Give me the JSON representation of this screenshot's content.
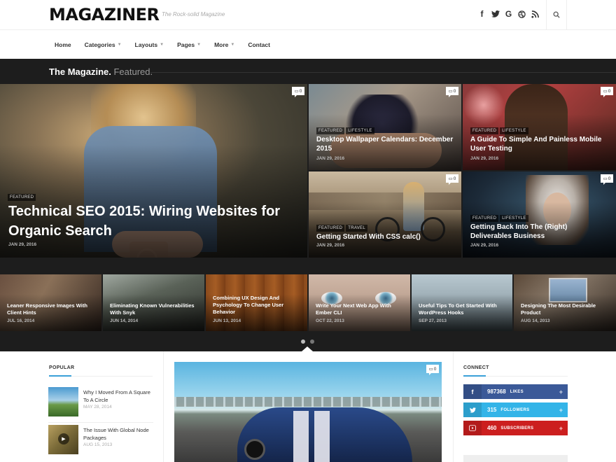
{
  "brand": {
    "logo": "MAGAZINER",
    "tagline": "The Rock-solid Magazine"
  },
  "social_icons": [
    "facebook-icon",
    "twitter-icon",
    "google-icon",
    "dribbble-icon",
    "rss-icon"
  ],
  "nav": [
    {
      "label": "Home",
      "has_caret": false
    },
    {
      "label": "Categories",
      "has_caret": true
    },
    {
      "label": "Layouts",
      "has_caret": true
    },
    {
      "label": "Pages",
      "has_caret": true
    },
    {
      "label": "More",
      "has_caret": true
    },
    {
      "label": "Contact",
      "has_caret": false
    }
  ],
  "featured": {
    "title": "The Magazine.",
    "subtitle": "Featured.",
    "big": {
      "cats": [
        "FEATURED"
      ],
      "title": "Technical SEO 2015: Wiring Websites for Organic Search",
      "date": "JAN 29, 2016",
      "comments": "0"
    },
    "small": [
      {
        "cats": [
          "FEATURED",
          "LIFESTYLE"
        ],
        "title": "Desktop Wallpaper Calendars: December 2015",
        "date": "JAN 29, 2016",
        "comments": "0"
      },
      {
        "cats": [
          "FEATURED",
          "LIFESTYLE"
        ],
        "title": "A Guide To Simple And Painless Mobile User Testing",
        "date": "JAN 29, 2016",
        "comments": "0"
      },
      {
        "cats": [
          "FEATURED",
          "TRAVEL"
        ],
        "title": "Getting Started With CSS calc()",
        "date": "JAN 29, 2016",
        "comments": "0"
      },
      {
        "cats": [
          "FEATURED",
          "LIFESTYLE"
        ],
        "title": "Getting Back Into The (Right) Deliverables Business",
        "date": "JAN 29, 2016",
        "comments": "0"
      }
    ]
  },
  "carousel": [
    {
      "title": "Leaner Responsive Images With Client Hints",
      "date": "JUL 16, 2014"
    },
    {
      "title": "Eliminating Known Vulnerabilities With Snyk",
      "date": "JUN 14, 2014"
    },
    {
      "title": "Combining UX Design And Psychology To Change User Behavior",
      "date": "JUN 13, 2014"
    },
    {
      "title": "Write Your Next Web App With Ember CLI",
      "date": "OCT 22, 2013"
    },
    {
      "title": "Useful Tips To Get Started With WordPress Hooks",
      "date": "SEP 27, 2013"
    },
    {
      "title": "Designing The Most Desirable Product",
      "date": "AUG 14, 2013"
    }
  ],
  "popular": {
    "heading": "POPULAR",
    "items": [
      {
        "title": "Why I Moved From A Square To A Circle",
        "date": "MAY 28, 2014"
      },
      {
        "title": "The Issue With Global Node Packages",
        "date": "AUG 15, 2013"
      }
    ]
  },
  "main_post": {
    "comments": "0"
  },
  "connect": {
    "heading": "CONNECT",
    "items": [
      {
        "icon": "facebook-icon",
        "count": "987368",
        "label": "LIKES",
        "color": "#3b5998"
      },
      {
        "icon": "twitter-icon",
        "count": "315",
        "label": "FOLLOWERS",
        "color": "#33b4e8"
      },
      {
        "icon": "youtube-icon",
        "count": "460",
        "label": "SUBSCRIBERS",
        "color": "#cc1f1f"
      }
    ]
  }
}
